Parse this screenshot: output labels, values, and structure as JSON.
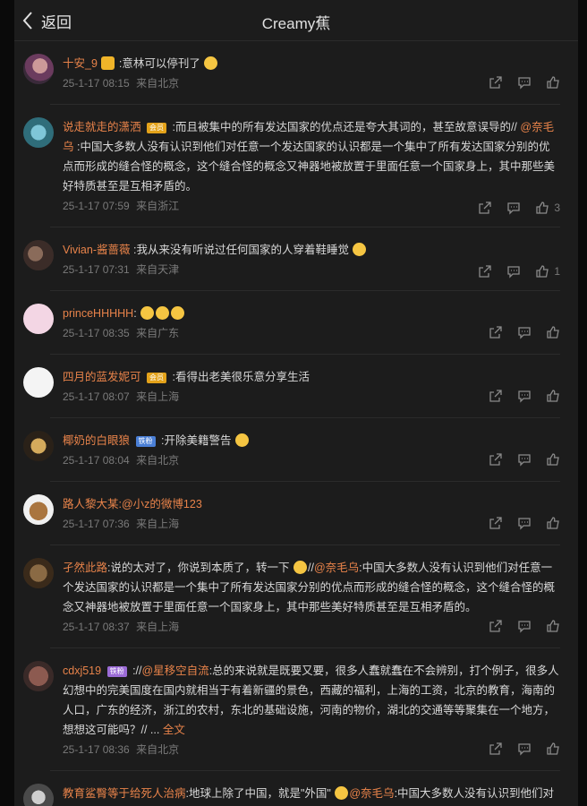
{
  "header": {
    "back_label": "返回",
    "title": "Creamy蕉"
  },
  "colors": {
    "accent": "#e8834a",
    "background": "#1c1c1c",
    "meta": "#7a7a7a"
  },
  "comments": [
    {
      "user": "十安_9",
      "body": ":意林可以停刊了",
      "time": "25-1-17 08:15",
      "loc": "来自北京",
      "likes": ""
    },
    {
      "user": "说走就走的潇洒",
      "badge": "会员",
      "body": ":而且被集中的所有发达国家的优点还是夸大其词的，甚至故意误导的//",
      "mention": "@奈毛乌",
      "body2": ":中国大多数人没有认识到他们对任意一个发达国家的认识都是一个集中了所有发达国家分别的优点而形成的缝合怪的概念，这个缝合怪的概念又神器地被放置于里面任意一个国家身上，其中那些美好特质甚至是互相矛盾的。",
      "time": "25-1-17 07:59",
      "loc": "来自浙江",
      "likes": "3"
    },
    {
      "user": "Vivian-酱蔷薇",
      "body": ":我从来没有听说过任何国家的人穿着鞋睡觉",
      "time": "25-1-17 07:31",
      "loc": "来自天津",
      "likes": "1"
    },
    {
      "user": "princeHHHHH",
      "body": ":",
      "time": "25-1-17 08:35",
      "loc": "来自广东",
      "likes": ""
    },
    {
      "user": "四月的蓝发妮可",
      "badge": "会员",
      "body": ":看得出老美很乐意分享生活",
      "time": "25-1-17 08:07",
      "loc": "来自上海",
      "likes": ""
    },
    {
      "user": "椰奶的白眼狼",
      "badge": "铁粉",
      "body": ":开除美籍警告",
      "time": "25-1-17 08:04",
      "loc": "来自北京",
      "likes": ""
    },
    {
      "user": "路人黎大某",
      "body": ":@小z的微博123",
      "time": "25-1-17 07:36",
      "loc": "来自上海",
      "likes": ""
    },
    {
      "user": "孑然此路",
      "body": ":说的太对了，你说到本质了，转一下",
      "body_b": "//",
      "mention": "@奈毛乌",
      "body2": ":中国大多数人没有认识到他们对任意一个发达国家的认识都是一个集中了所有发达国家分别的优点而形成的缝合怪的概念，这个缝合怪的概念又神器地被放置于里面任意一个国家身上，其中那些美好特质甚至是互相矛盾的。",
      "time": "25-1-17 08:37",
      "loc": "来自上海",
      "likes": ""
    },
    {
      "user": "cdxj519",
      "badge": "铁粉",
      "body": "://",
      "mention": "@星移空自流",
      "body2": ":总的来说就是既要又要，很多人蠢就蠢在不会辨别，打个例子，很多人幻想中的完美国度在国内就相当于有着新疆的景色，西藏的福利，上海的工资，北京的教育，海南的人口，广东的经济，浙江的农村，东北的基础设施，河南的物价，湖北的交通等等聚集在一个地方，想想这可能吗？// ...",
      "fulltext": "全文",
      "time": "25-1-17 08:36",
      "loc": "来自北京",
      "likes": ""
    },
    {
      "user": "教育鲨臀等于给死人治病",
      "body": ":地球上除了中国，就是\"外国\"",
      "mention": "@奈毛乌",
      "body2": ":中国大多数人没有认识到他们对任意一个发达国家的认识都是一个集中了所有发达国家分别的优点而形成的缝合怪的概念，这个缝合怪的概念又神器地被放置于里面任意一个国家身上，其中那些美好特质甚至是互相矛盾的。",
      "time": "",
      "loc": "",
      "likes": ""
    }
  ]
}
